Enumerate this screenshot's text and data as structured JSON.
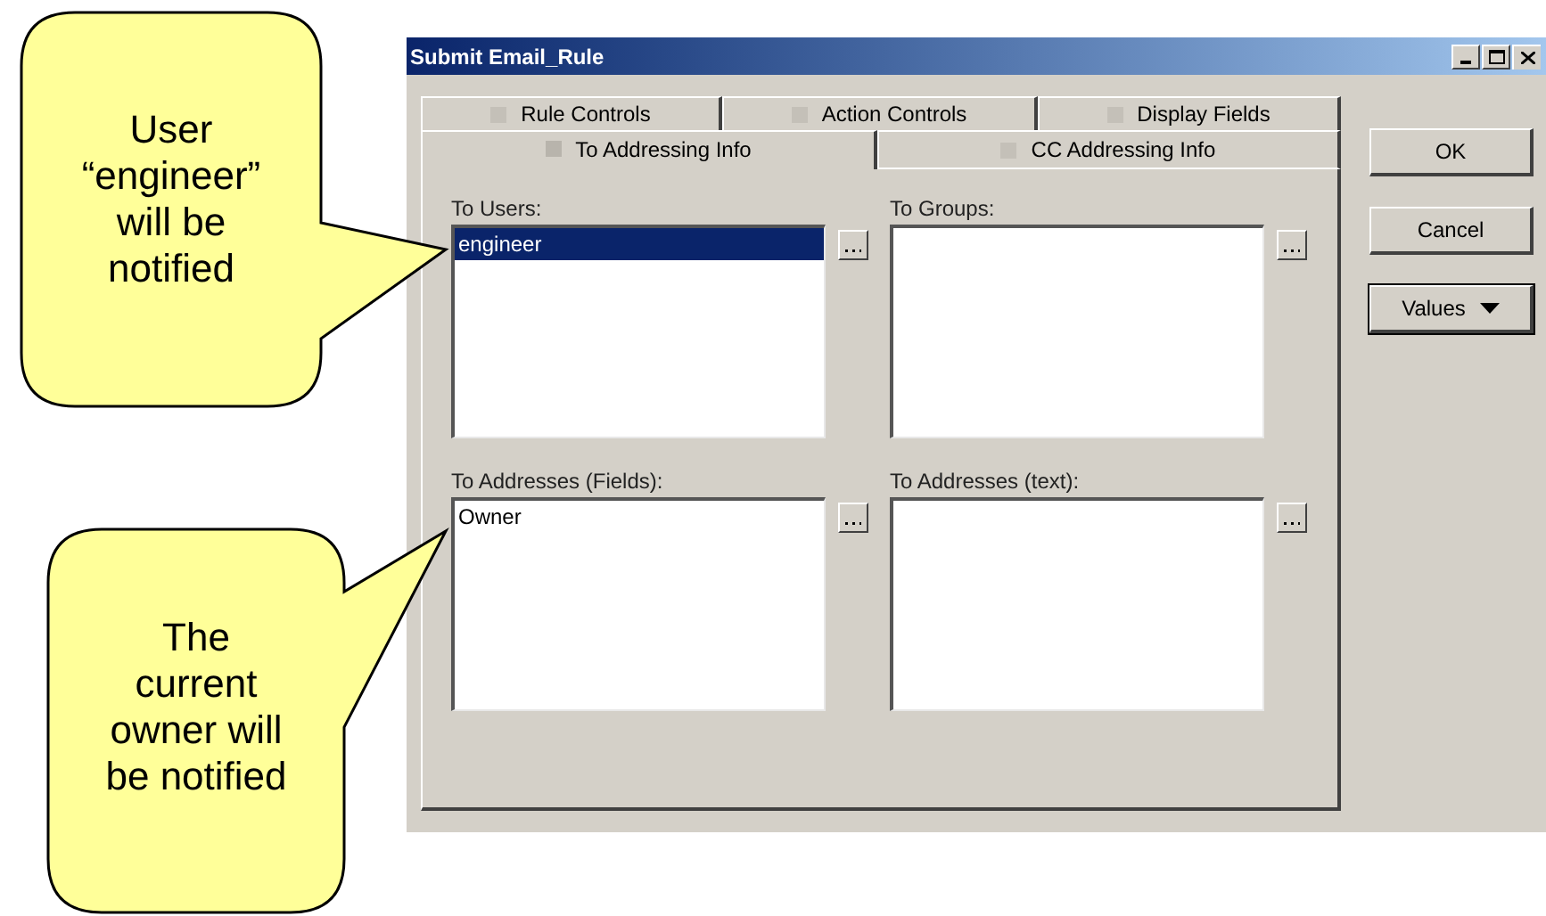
{
  "callouts": [
    {
      "text": "User “engineer” will be notified"
    },
    {
      "text": "The current owner will be notified"
    }
  ],
  "window": {
    "title": "Submit Email_Rule"
  },
  "tab_rows": [
    [
      {
        "label": "Rule Controls",
        "selected": false
      },
      {
        "label": "Action Controls",
        "selected": false
      },
      {
        "label": "Display Fields",
        "selected": false
      }
    ],
    [
      {
        "label": "To Addressing Info",
        "selected": true
      },
      {
        "label": "CC Addressing Info",
        "selected": false
      }
    ]
  ],
  "lists": [
    {
      "label": "To Users:",
      "items": [
        {
          "text": "engineer",
          "selected": true
        }
      ]
    },
    {
      "label": "To Groups:"
    },
    {
      "label": "To Addresses (Fields):",
      "items": [
        {
          "text": "Owner",
          "selected": false
        }
      ]
    },
    {
      "label": "To Addresses (text):"
    }
  ],
  "buttons": [
    {
      "label": "OK",
      "kind": "plain"
    },
    {
      "label": "Cancel",
      "kind": "plain"
    },
    {
      "label": "Values",
      "kind": "dropdown"
    }
  ]
}
